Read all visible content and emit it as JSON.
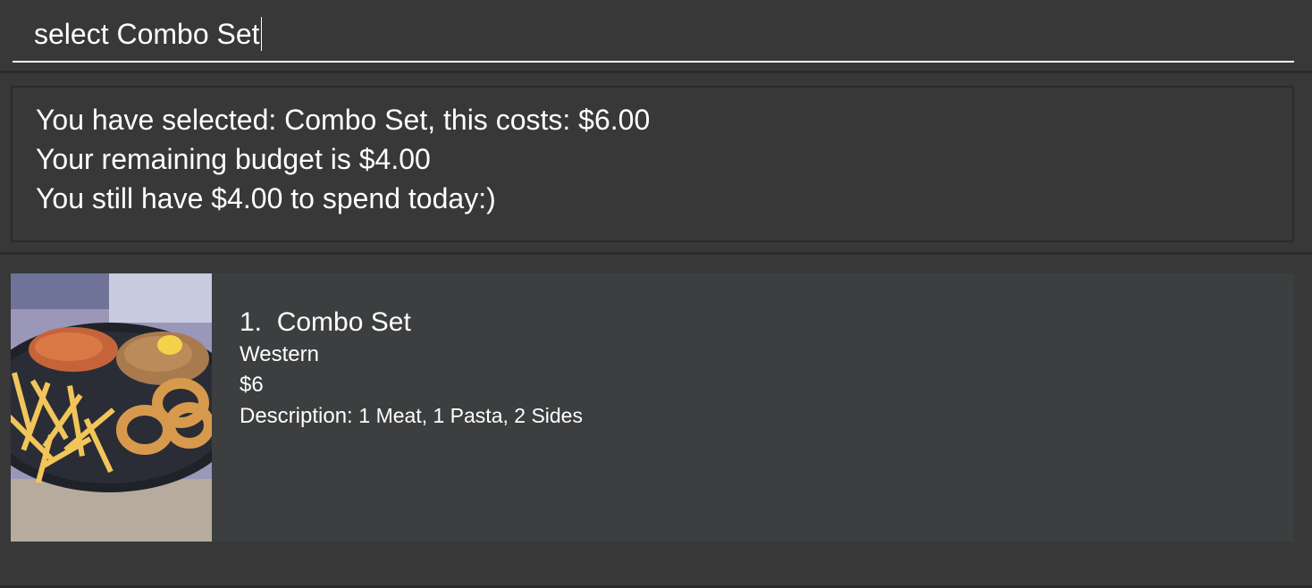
{
  "command": {
    "value": "select Combo Set"
  },
  "result": {
    "lines": [
      "You have selected: Combo Set, this costs: $6.00",
      "Your remaining budget is $4.00",
      "You still have $4.00 to spend today:)"
    ]
  },
  "food_list": [
    {
      "index": "1.",
      "name": "Combo Set",
      "category": "Western",
      "price": "$6",
      "description_label": "Description:",
      "description": "1 Meat, 1 Pasta, 2 Sides"
    }
  ]
}
